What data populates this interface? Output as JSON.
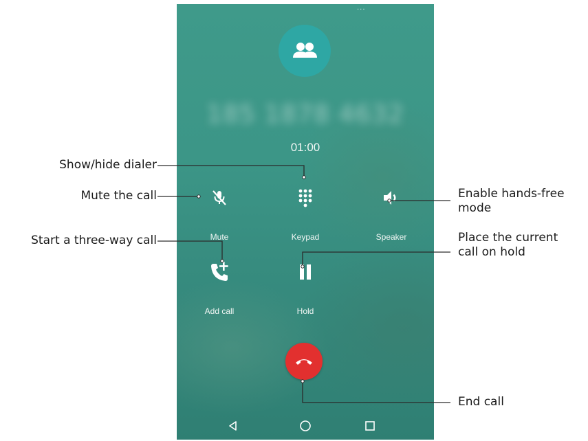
{
  "screen": {
    "status_indicator": "...",
    "caller_number": "185 1878 4632",
    "call_timer": "01:00"
  },
  "controls": {
    "mute_label": "Mute",
    "keypad_label": "Keypad",
    "speaker_label": "Speaker",
    "add_call_label": "Add call",
    "hold_label": "Hold"
  },
  "icons": {
    "avatar": "group-avatar-icon",
    "mute": "mic-off-icon",
    "keypad": "dialpad-icon",
    "speaker": "volume-up-icon",
    "add_call": "add-call-icon",
    "hold": "pause-icon",
    "end_call": "call-end-icon",
    "nav_back": "triangle-back-icon",
    "nav_home": "circle-home-icon",
    "nav_recents": "square-recents-icon"
  },
  "colors": {
    "background": "#3c9687",
    "avatar": "#2ea7a4",
    "end_call": "#e2302f",
    "text_on_screen": "#f2f7f5"
  },
  "annotations": {
    "show_hide_dialer": "Show/hide dialer",
    "mute_the_call": "Mute the call",
    "start_three_way": "Start a three-way call",
    "hands_free_line1": "Enable hands-free",
    "hands_free_line2": "mode",
    "hold_line1": "Place the current",
    "hold_line2": "call on hold",
    "end_call": "End call"
  }
}
